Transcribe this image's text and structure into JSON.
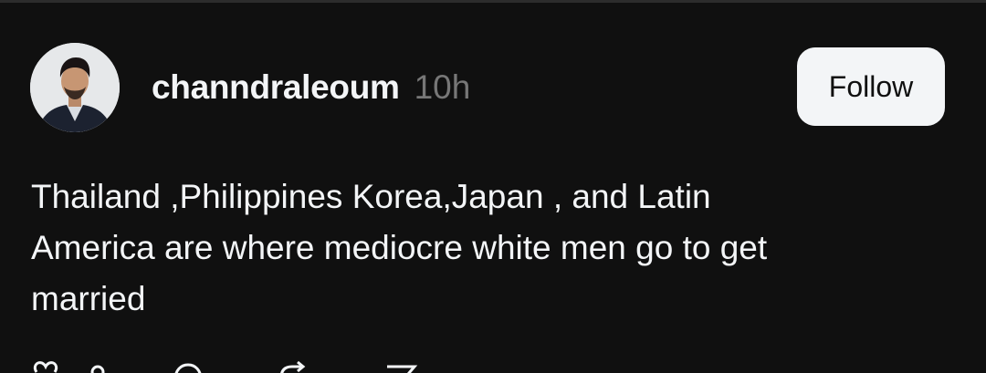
{
  "post": {
    "username": "channdraleoum",
    "timestamp": "10h",
    "follow_label": "Follow",
    "text": "Thailand ,Philippines Korea,Japan , and Latin\nAmerica are where mediocre white men go to get\nmarried"
  },
  "icons": {
    "avatar": "avatar-photo",
    "like": "heart-icon",
    "comment": "comment-icon",
    "repost": "repost-icon",
    "share": "share-icon"
  }
}
